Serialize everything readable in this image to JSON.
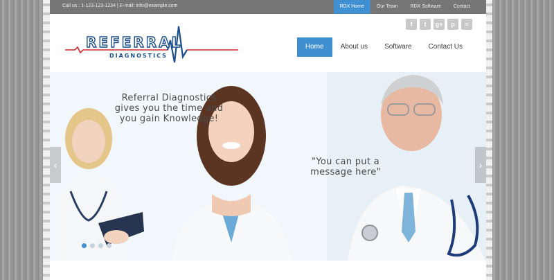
{
  "topbar": {
    "contact": "Call us : 1-123-123-1234 | E-mail: info@example.com",
    "nav": [
      {
        "label": "RDX Home",
        "active": true
      },
      {
        "label": "Our Team",
        "active": false
      },
      {
        "label": "RDX Software",
        "active": false
      },
      {
        "label": "Contact",
        "active": false
      }
    ]
  },
  "logo": {
    "text": "REFERRAL",
    "sub": "DIAGNOSTICS"
  },
  "social": [
    "facebook-icon",
    "twitter-icon",
    "googleplus-icon",
    "pinterest-icon",
    "rss-icon"
  ],
  "social_glyphs": [
    "f",
    "t",
    "g+",
    "p",
    "≈"
  ],
  "main_nav": [
    {
      "label": "Home",
      "active": true
    },
    {
      "label": "About us",
      "active": false
    },
    {
      "label": "Software",
      "active": false
    },
    {
      "label": "Contact Us",
      "active": false
    }
  ],
  "slider": {
    "caption1": "Referral Diagnostics gives you the time and you gain Knowledge!",
    "caption2": "\"You can put a message here\"",
    "prev_arrow": "‹",
    "next_arrow": "›"
  },
  "colors": {
    "accent": "#3f8fd1",
    "topbar": "#767676",
    "logo_red": "#d6262c",
    "logo_blue": "#1b4f8f"
  }
}
